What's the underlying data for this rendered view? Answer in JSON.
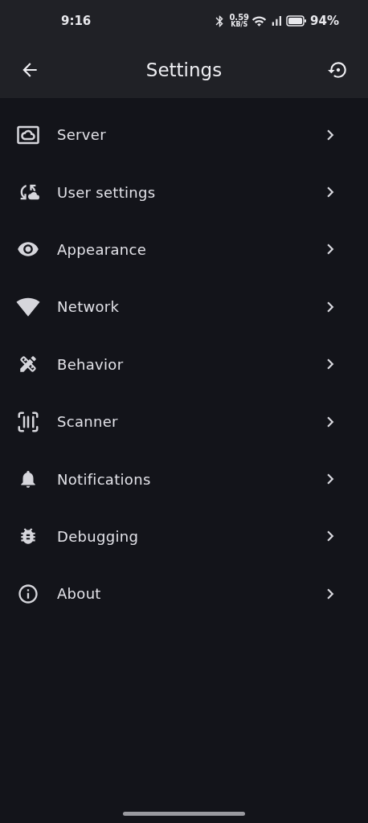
{
  "status_bar": {
    "time": "9:16",
    "speed": "0.59",
    "speed_unit": "KB/S",
    "battery": "94%"
  },
  "app_bar": {
    "title": "Settings"
  },
  "items": [
    {
      "kind": "server",
      "label": "Server"
    },
    {
      "kind": "user",
      "label": "User settings"
    },
    {
      "kind": "appearance",
      "label": "Appearance"
    },
    {
      "kind": "network",
      "label": "Network"
    },
    {
      "kind": "behavior",
      "label": "Behavior"
    },
    {
      "kind": "scanner",
      "label": "Scanner"
    },
    {
      "kind": "notifications",
      "label": "Notifications"
    },
    {
      "kind": "debugging",
      "label": "Debugging"
    },
    {
      "kind": "about",
      "label": "About"
    }
  ]
}
